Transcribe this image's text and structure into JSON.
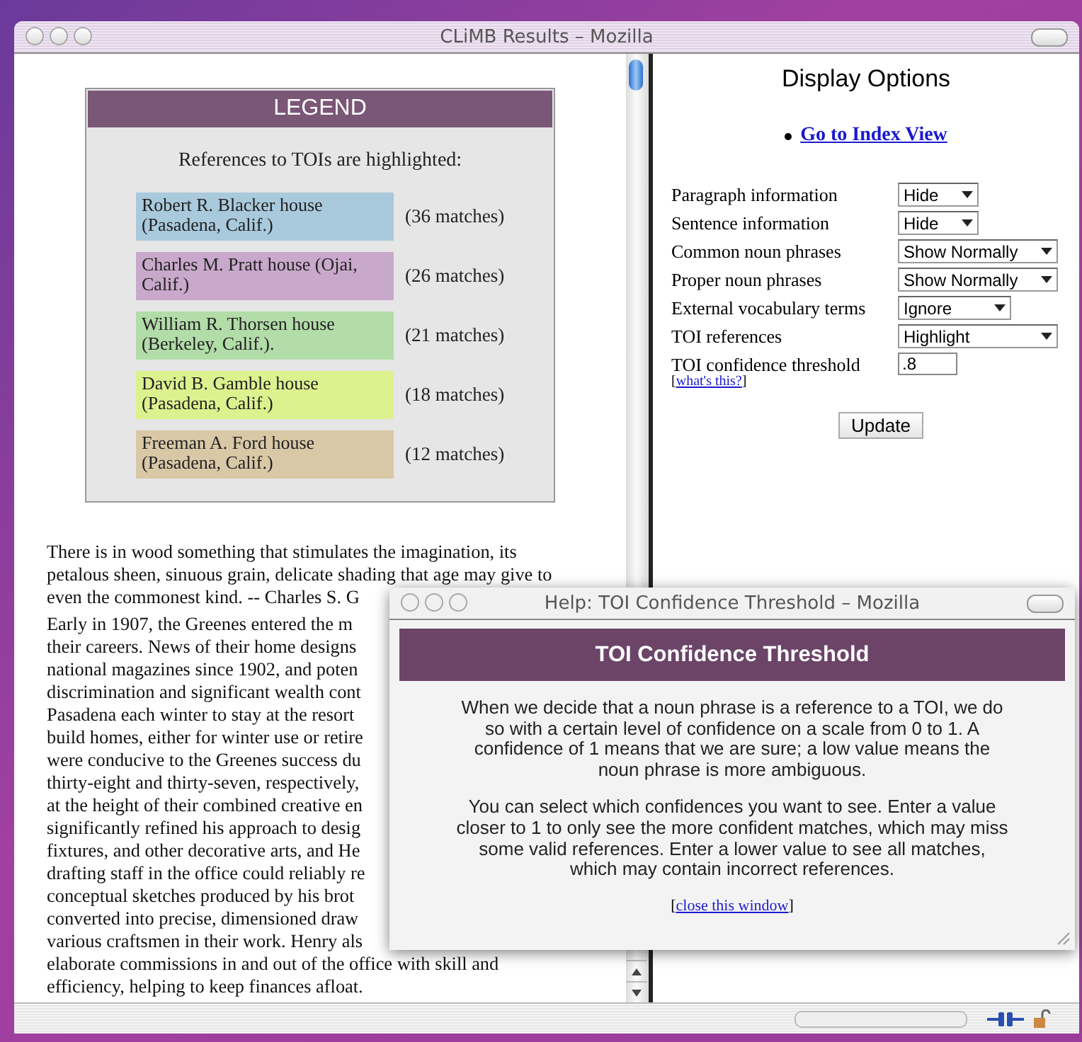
{
  "window": {
    "title": "CLiMB Results – Mozilla"
  },
  "legend": {
    "title": "LEGEND",
    "caption": "References to TOIs are highlighted:",
    "entries": [
      {
        "name": "Robert R. Blacker house (Pasadena, Calif.)",
        "count": "(36 matches)",
        "color": "#a9c9dc"
      },
      {
        "name": "Charles M. Pratt house (Ojai, Calif.)",
        "count": "(26 matches)",
        "color": "#c9a9cb"
      },
      {
        "name": "William R. Thorsen house (Berkeley, Calif.).",
        "count": "(21 matches)",
        "color": "#b2dca8"
      },
      {
        "name": "David B. Gamble house (Pasadena, Calif.)",
        "count": "(18 matches)",
        "color": "#dcf28e"
      },
      {
        "name": "Freeman A. Ford house (Pasadena, Calif.)",
        "count": "(12 matches)",
        "color": "#d9c8a6"
      }
    ]
  },
  "paragraphs": [
    [
      "There is in wood something that stimulates the imagination, its",
      "petalous sheen, sinuous grain, delicate shading that age may give to",
      "even the commonest kind. -- Charles S. G"
    ],
    [
      "Early in 1907, the Greenes entered the m",
      "their careers. News of their home designs",
      "national magazines since 1902, and poten",
      "discrimination and significant wealth cont",
      "Pasadena each winter to stay at the resort",
      "build homes, either for winter use or retire",
      "were conducive to the Greenes success du",
      "thirty-eight and thirty-seven, respectively,",
      "at the height of their combined creative en",
      "significantly refined his approach to desig",
      "fixtures, and other decorative arts, and He",
      "drafting staff in the office could reliably re",
      "conceptual sketches produced by his brot",
      "converted into precise, dimensioned draw",
      "various craftsmen in their work. Henry als",
      "elaborate commissions in and out of the office with skill and",
      "efficiency, helping to keep finances afloat."
    ]
  ],
  "display_options": {
    "heading": "Display Options",
    "links": [
      "Go to Index View"
    ],
    "options": [
      {
        "kind": "select",
        "label": "Paragraph information",
        "value": "Hide"
      },
      {
        "kind": "select",
        "label": "Sentence information",
        "value": "Hide"
      },
      {
        "kind": "select",
        "label": "Common noun phrases",
        "value": "Show Normally"
      },
      {
        "kind": "select",
        "label": "Proper noun phrases",
        "value": "Show Normally"
      },
      {
        "kind": "select",
        "label": "External vocabulary terms",
        "value": "Ignore"
      },
      {
        "kind": "select",
        "label": "TOI references",
        "value": "Highlight"
      },
      {
        "kind": "text",
        "label": "TOI confidence threshold",
        "value": ".8",
        "help": {
          "before": "[",
          "link": "what's this?",
          "after": "]"
        }
      }
    ],
    "update_button": "Update"
  },
  "help_window": {
    "title": "Help: TOI Confidence Threshold – Mozilla",
    "heading": "TOI Confidence Threshold",
    "paragraphs": [
      "When we decide that a noun phrase is a reference to a TOI, we do so with a certain level of confidence on a scale from 0 to 1. A confidence of 1 means that we are sure; a low value means the noun phrase is more ambiguous.",
      "You can select which confidences you want to see. Enter a value closer to 1 to only see the more confident matches, which may miss some valid references. Enter a lower value to see all matches, which may contain incorrect references."
    ],
    "close_link": {
      "before": "[",
      "link": "close this window",
      "after": "]"
    }
  }
}
